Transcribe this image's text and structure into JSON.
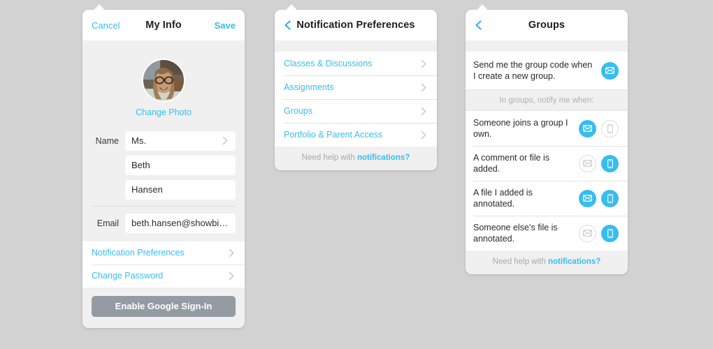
{
  "theme": {
    "accent": "#37bdf0",
    "page_bg": "#d2d2d2",
    "panel_bg": "#f0f0f0",
    "card_bg": "#ffffff",
    "button_gray": "#959ba3",
    "muted_text": "#a8a8a8"
  },
  "panel_my_info": {
    "header": {
      "cancel_label": "Cancel",
      "title": "My Info",
      "save_label": "Save"
    },
    "avatar": {
      "change_photo_label": "Change Photo",
      "icon": "user-avatar-photo"
    },
    "fields": [
      {
        "label": "Name",
        "value": "Ms.",
        "has_chevron": true
      },
      {
        "label": "",
        "value": "Beth",
        "has_chevron": false
      },
      {
        "label": "",
        "value": "Hansen",
        "has_chevron": false
      }
    ],
    "email_field": {
      "label": "Email",
      "value": "beth.hansen@showbie.c…",
      "has_chevron": false
    },
    "links": [
      {
        "label": "Notification Preferences",
        "chevron": "chevron-right-icon"
      },
      {
        "label": "Change Password",
        "chevron": "chevron-right-icon"
      }
    ],
    "google_button_label": "Enable Google Sign-In"
  },
  "panel_notification_preferences": {
    "header": {
      "back_icon": "chevron-left-icon",
      "title": "Notification Preferences"
    },
    "items": [
      {
        "label": "Classes & Discussions",
        "chevron": "chevron-right-icon"
      },
      {
        "label": "Assignments",
        "chevron": "chevron-right-icon"
      },
      {
        "label": "Groups",
        "chevron": "chevron-right-icon"
      },
      {
        "label": "Portfolio & Parent Access",
        "chevron": "chevron-right-icon"
      }
    ],
    "help": {
      "prefix": "Need help with ",
      "link": "notifications?"
    }
  },
  "panel_groups": {
    "header": {
      "back_icon": "chevron-left-icon",
      "title": "Groups"
    },
    "top_rule": {
      "text": "Send me the group code when I create a new group.",
      "email_on": true,
      "device_shown": false
    },
    "section_label": "In groups, notify me when:",
    "rules": [
      {
        "text": "Someone joins a group I own.",
        "email_on": true,
        "device_on": false
      },
      {
        "text": "A comment or file is added.",
        "email_on": false,
        "device_on": true
      },
      {
        "text": "A file I added is annotated.",
        "email_on": true,
        "device_on": true
      },
      {
        "text": "Someone else’s file is annotated.",
        "email_on": false,
        "device_on": true
      }
    ],
    "help": {
      "prefix": "Need help with ",
      "link": "notifications?"
    }
  }
}
